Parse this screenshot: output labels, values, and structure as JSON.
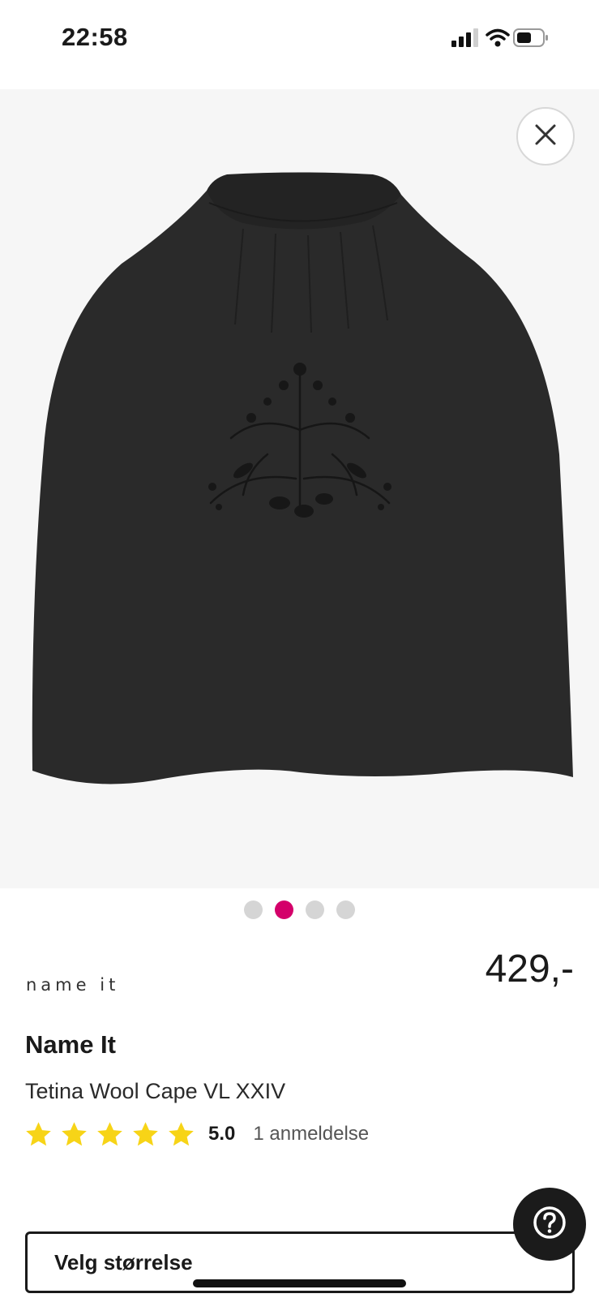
{
  "status_bar": {
    "time": "22:58",
    "icons": [
      "signal-icon",
      "wifi-icon",
      "battery-icon"
    ]
  },
  "gallery": {
    "image_description": "black-wool-cape-with-embroidery",
    "close_icon": "close-icon",
    "page_count": 4,
    "active_index": 1,
    "colors": {
      "active_dot": "#d4006a",
      "inactive_dot": "#d5d5d5"
    }
  },
  "product": {
    "brand_logo": "name it",
    "price": "429,-",
    "brand": "Name It",
    "name": "Tetina Wool Cape VL XXIV",
    "rating": {
      "stars": 5,
      "value": "5.0",
      "reviews": "1 anmeldelse",
      "star_color": "#f7d417"
    }
  },
  "size_selector": {
    "label": "Velg størrelse"
  },
  "help": {
    "icon": "help-icon"
  }
}
